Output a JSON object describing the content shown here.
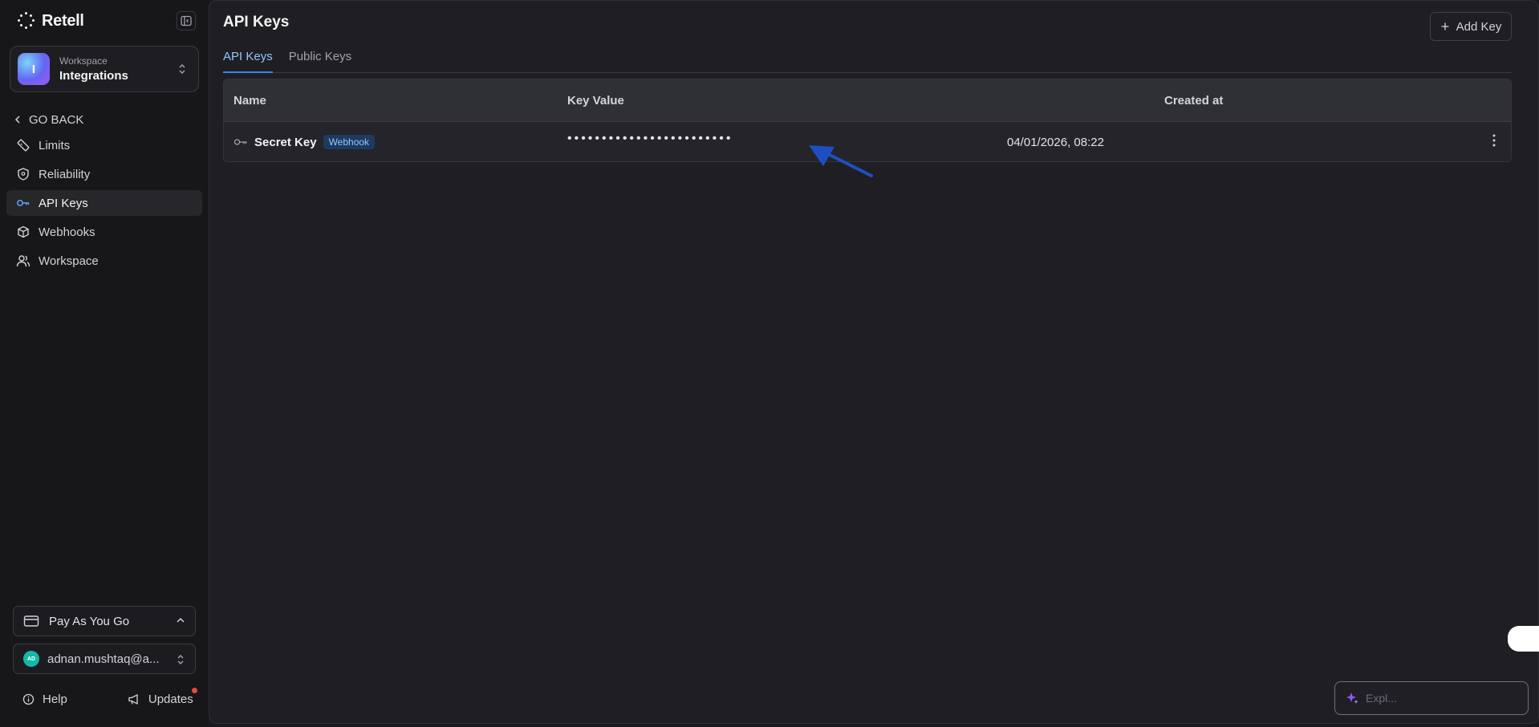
{
  "brand": {
    "name": "Retell"
  },
  "workspace": {
    "label": "Workspace",
    "name": "Integrations",
    "initial": "I"
  },
  "sidebar": {
    "go_back": "GO BACK",
    "items": [
      {
        "label": "Limits",
        "icon": "ruler-icon"
      },
      {
        "label": "Reliability",
        "icon": "shield-icon"
      },
      {
        "label": "API Keys",
        "icon": "key-icon",
        "active": true
      },
      {
        "label": "Webhooks",
        "icon": "cube-icon"
      },
      {
        "label": "Workspace",
        "icon": "users-icon"
      }
    ],
    "plan": "Pay As You Go",
    "user": {
      "initials": "AD",
      "email": "adnan.mushtaq@a..."
    },
    "help": "Help",
    "updates": "Updates"
  },
  "header": {
    "title": "API Keys",
    "add_key": "Add Key"
  },
  "tabs": [
    {
      "label": "API Keys",
      "active": true
    },
    {
      "label": "Public Keys",
      "active": false
    }
  ],
  "table": {
    "columns": [
      "Name",
      "Key Value",
      "Created at"
    ],
    "rows": [
      {
        "name": "Secret Key",
        "badge": "Webhook",
        "key_value": "••••••••••••••••••••••••",
        "created_at": "04/01/2026, 08:22"
      }
    ]
  },
  "explain": {
    "label": "Expl..."
  },
  "colors": {
    "accent": "#3b82f6",
    "annotation_arrow": "#1e4fc2"
  }
}
